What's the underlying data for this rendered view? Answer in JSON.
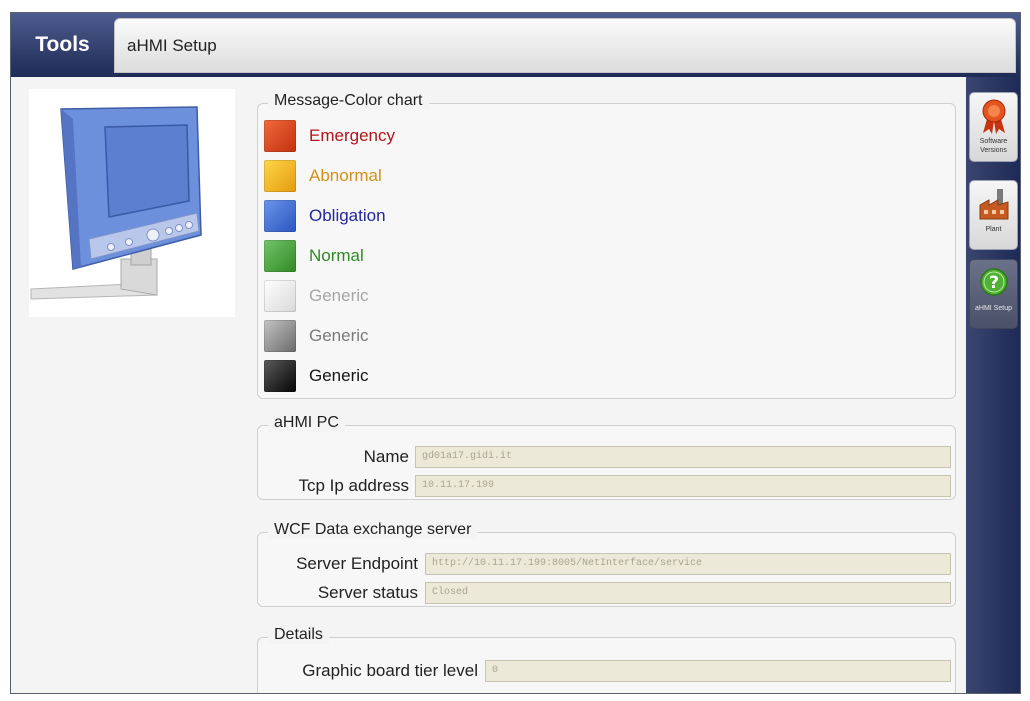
{
  "header": {
    "section": "Tools",
    "tab_title": "aHMI Setup"
  },
  "message_color_chart": {
    "title": "Message-Color chart",
    "items": [
      {
        "label": "Emergency",
        "swatch_color": "#d8431e",
        "text_color": "#b3151b"
      },
      {
        "label": "Abnormal",
        "swatch_color": "#f0b21c",
        "text_color": "#d3901a"
      },
      {
        "label": "Obligation",
        "swatch_color": "#3a6ad3",
        "text_color": "#23269c"
      },
      {
        "label": "Normal",
        "swatch_color": "#44a13d",
        "text_color": "#2f8a23"
      },
      {
        "label": "Generic",
        "swatch_color": "#eeeeee",
        "text_color": "#a6a6a6"
      },
      {
        "label": "Generic",
        "swatch_color": "#8c8c8c",
        "text_color": "#7a7a7a"
      },
      {
        "label": "Generic",
        "swatch_color": "#151515",
        "text_color": "#151515"
      }
    ]
  },
  "ahmi_pc": {
    "title": "aHMI PC",
    "name_label": "Name",
    "name_value": "gd01a17.gidi.it",
    "ip_label": "Tcp Ip address",
    "ip_value": "10.11.17.199"
  },
  "wcf": {
    "title": "WCF Data exchange server",
    "endpoint_label": "Server Endpoint",
    "endpoint_value": "http://10.11.17.199:8005/NetInterface/service",
    "status_label": "Server status",
    "status_value": "Closed"
  },
  "details": {
    "title": "Details",
    "tier_label": "Graphic board tier level",
    "tier_value": "0"
  },
  "side_toolbar": {
    "items": [
      {
        "label": "Software Versions",
        "icon": "award-ribbon-icon"
      },
      {
        "label": "Plant",
        "icon": "plant-factory-icon"
      },
      {
        "label": "aHMI Setup",
        "icon": "help-question-icon"
      }
    ],
    "active_index": 2
  },
  "colors": {
    "header_bg": "#2d3a6a",
    "field_bg": "#ece9d8",
    "field_text": "#a9a591"
  }
}
